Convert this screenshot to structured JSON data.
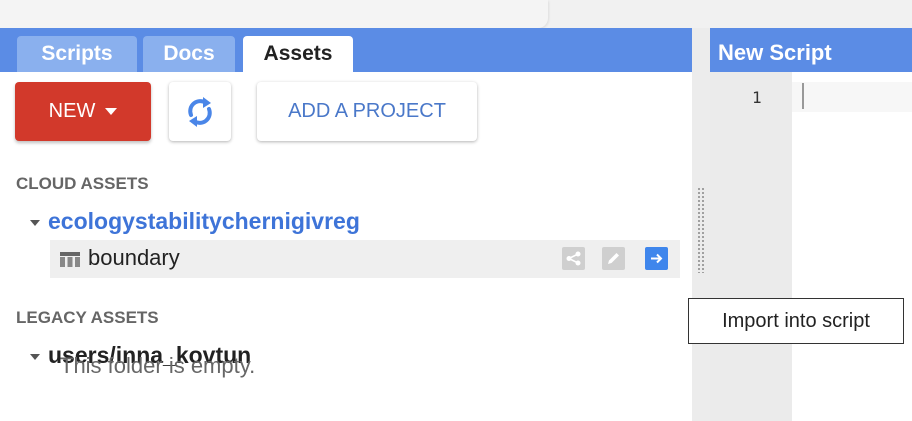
{
  "tabs": {
    "scripts": "Scripts",
    "docs": "Docs",
    "assets": "Assets"
  },
  "toolbar": {
    "new_label": "NEW",
    "add_project_label": "ADD A PROJECT"
  },
  "cloud_assets": {
    "heading": "CLOUD ASSETS",
    "project": "ecologystabilitychernigivreg",
    "items": [
      {
        "name": "boundary",
        "type_icon": "table-icon"
      }
    ]
  },
  "legacy_assets": {
    "heading": "LEGACY ASSETS",
    "folder": "users/inna_kovtun",
    "empty_text": "This folder is empty."
  },
  "editor": {
    "title": "New Script",
    "line_number": "1"
  },
  "tooltip": {
    "text": "Import into script"
  },
  "colors": {
    "accent": "#5b8ce5",
    "new_button": "#d2392b",
    "link": "#3e74d8",
    "import_button": "#3f86ec"
  }
}
